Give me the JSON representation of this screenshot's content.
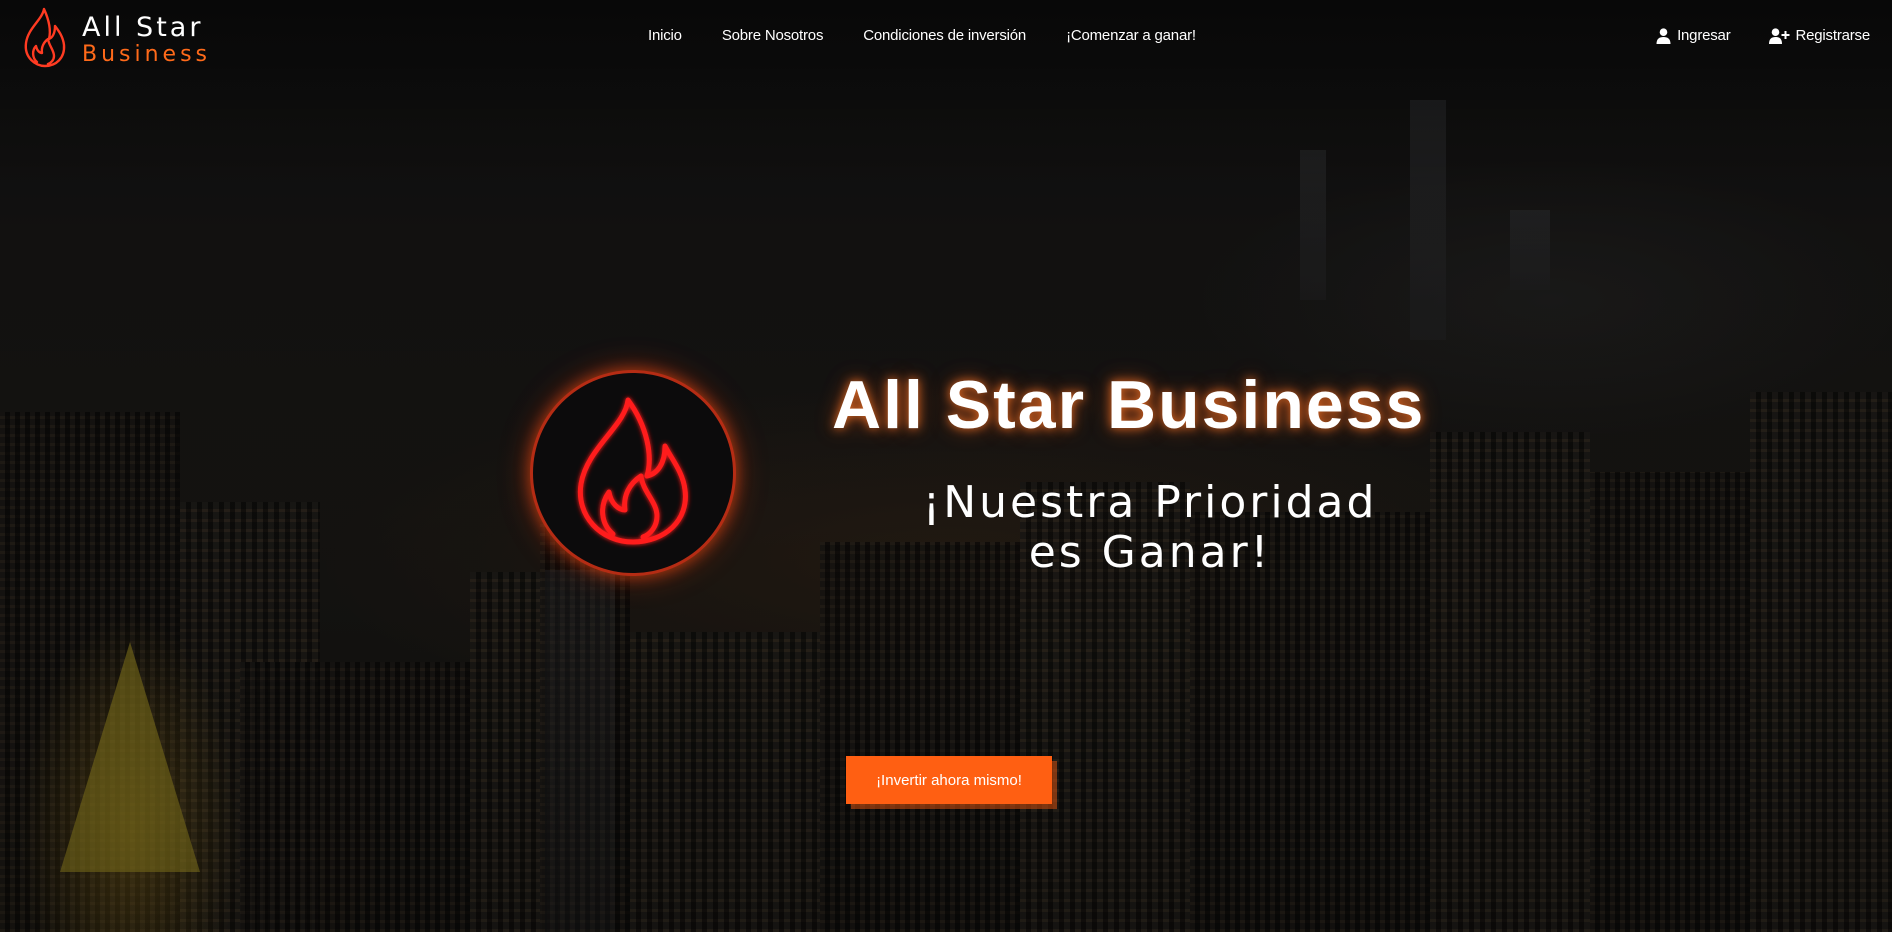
{
  "brand": {
    "line1": "All Star",
    "line2": "Business",
    "logo_icon": "flame-icon"
  },
  "nav": {
    "links": [
      {
        "label": "Inicio"
      },
      {
        "label": "Sobre Nosotros"
      },
      {
        "label": "Condiciones de inversión"
      },
      {
        "label": "¡Comenzar a ganar!"
      }
    ],
    "login": {
      "label": "Ingresar",
      "icon": "user-icon"
    },
    "register": {
      "label": "Registrarse",
      "icon": "user-plus-icon"
    }
  },
  "hero": {
    "title": "All Star Business",
    "subtitle_line1": "¡Nuestra Prioridad",
    "subtitle_line2": "es Ganar!",
    "cta_label": "¡Invertir ahora mismo!",
    "logo_icon": "flame-icon"
  },
  "colors": {
    "accent": "#ff5f12",
    "brand_orange": "#ff6a1a",
    "neon_red": "#ff2a1a",
    "text": "#ffffff"
  }
}
